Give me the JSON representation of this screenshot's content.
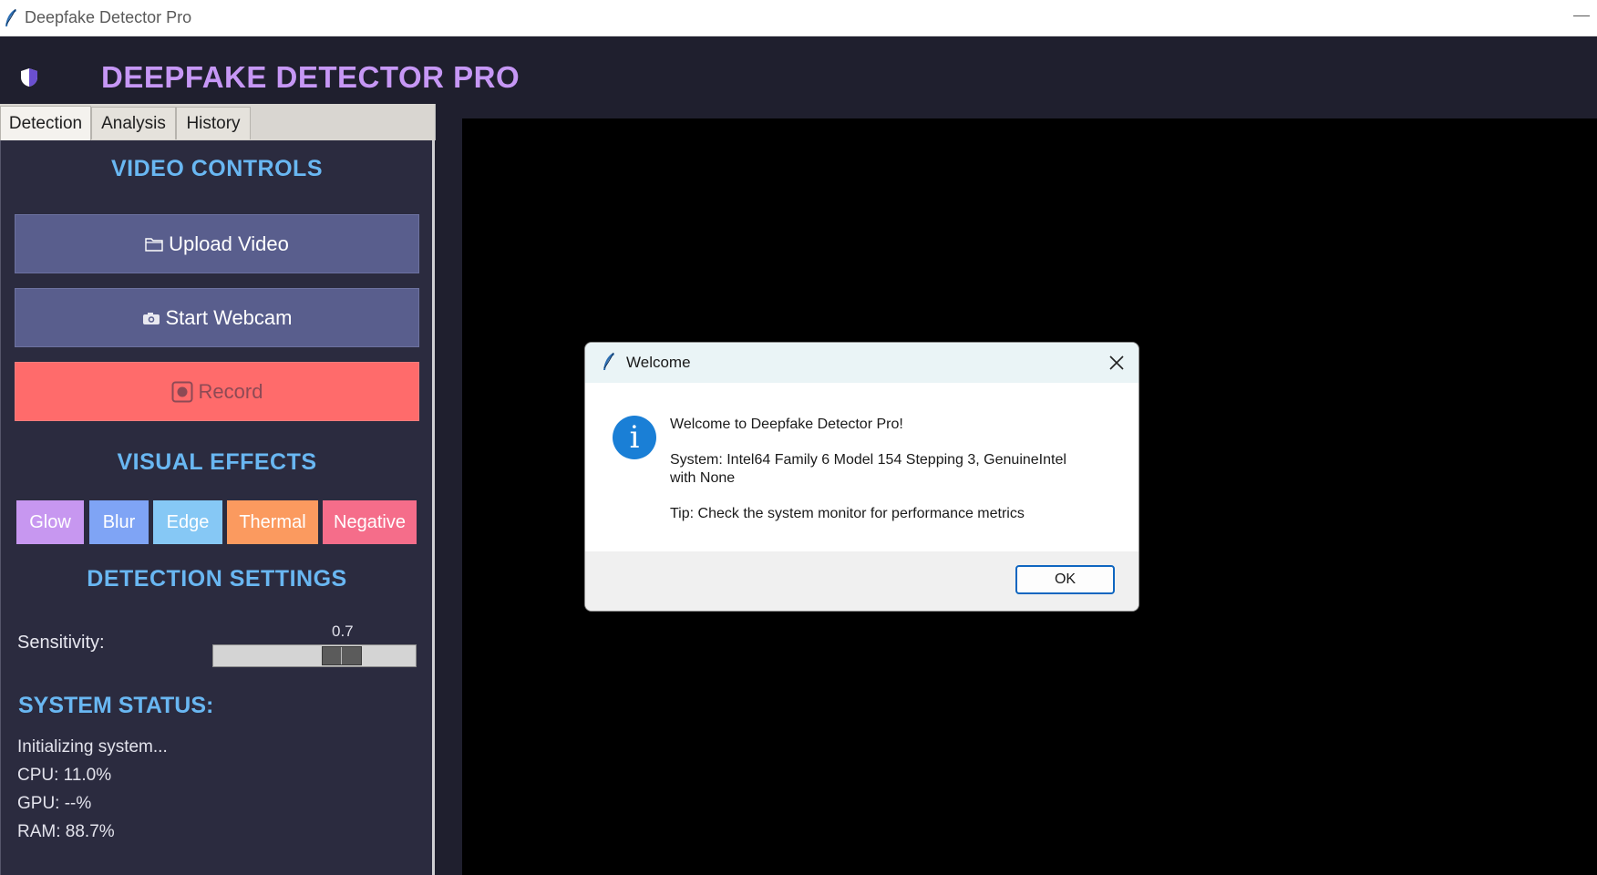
{
  "window": {
    "title": "Deepfake Detector Pro"
  },
  "header": {
    "title": "DEEPFAKE DETECTOR PRO"
  },
  "tabs": [
    {
      "label": "Detection",
      "active": true
    },
    {
      "label": "Analysis",
      "active": false
    },
    {
      "label": "History",
      "active": false
    }
  ],
  "video_controls": {
    "title": "VIDEO CONTROLS",
    "upload_label": "Upload Video",
    "webcam_label": "Start Webcam",
    "record_label": "Record"
  },
  "visual_effects": {
    "title": "VISUAL EFFECTS",
    "buttons": [
      {
        "label": "Glow",
        "color": "#c797f0"
      },
      {
        "label": "Blur",
        "color": "#7fa4f5"
      },
      {
        "label": "Edge",
        "color": "#86c8f5"
      },
      {
        "label": "Thermal",
        "color": "#fb9a5f"
      },
      {
        "label": "Negative",
        "color": "#f56d8a"
      }
    ]
  },
  "detection_settings": {
    "title": "DETECTION SETTINGS",
    "sensitivity_label": "Sensitivity:",
    "sensitivity_value": "0.7",
    "sensitivity_level": 0.7
  },
  "system_status": {
    "title": "SYSTEM STATUS:",
    "message": "Initializing system...",
    "cpu": "CPU: 11.0%",
    "gpu": "GPU: --%",
    "ram": "RAM: 88.7%"
  },
  "dialog": {
    "title": "Welcome",
    "heading": "Welcome to Deepfake Detector Pro!",
    "system_line1": "System: Intel64 Family 6 Model 154 Stepping 3, GenuineIntel",
    "system_line2": "with None",
    "tip": "Tip: Check the system monitor for performance metrics",
    "ok_label": "OK"
  },
  "colors": {
    "accent_title": "#c697f5",
    "section_title": "#69b7f2",
    "button": "#595e8d",
    "record": "#ff6b6b"
  }
}
